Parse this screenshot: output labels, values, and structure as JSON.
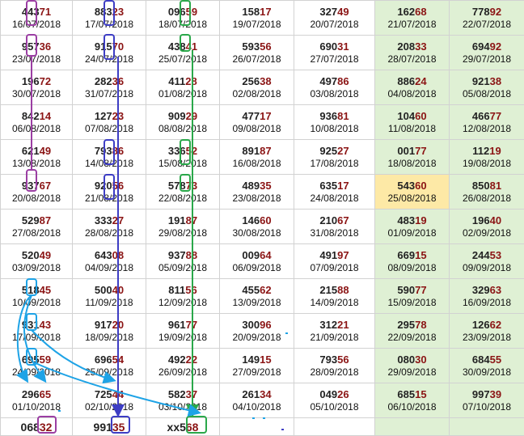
{
  "colors": {
    "green_column": "#dff0d4",
    "highlight_cell": "#fde9a6",
    "number_tail": "#8b1414",
    "grid_line": "#d2d2d2",
    "mark_purple": "#9b3ea3",
    "mark_blue": "#3d3dc4",
    "mark_green": "#2aa84a",
    "mark_cyan": "#1ea3e6"
  },
  "rows": [
    [
      {
        "head": "443",
        "tail": "71",
        "date": "16/07/2018"
      },
      {
        "head": "883",
        "tail": "23",
        "date": "17/07/2018"
      },
      {
        "head": "096",
        "tail": "59",
        "date": "18/07/2018"
      },
      {
        "head": "158",
        "tail": "17",
        "date": "19/07/2018"
      },
      {
        "head": "327",
        "tail": "49",
        "date": "20/07/2018"
      },
      {
        "head": "162",
        "tail": "68",
        "date": "21/07/2018"
      },
      {
        "head": "778",
        "tail": "92",
        "date": "22/07/2018"
      }
    ],
    [
      {
        "head": "957",
        "tail": "36",
        "date": "23/07/2018"
      },
      {
        "head": "915",
        "tail": "70",
        "date": "24/07/2018"
      },
      {
        "head": "438",
        "tail": "41",
        "date": "25/07/2018"
      },
      {
        "head": "593",
        "tail": "56",
        "date": "26/07/2018"
      },
      {
        "head": "690",
        "tail": "31",
        "date": "27/07/2018"
      },
      {
        "head": "208",
        "tail": "33",
        "date": "28/07/2018"
      },
      {
        "head": "694",
        "tail": "92",
        "date": "29/07/2018"
      }
    ],
    [
      {
        "head": "196",
        "tail": "72",
        "date": "30/07/2018"
      },
      {
        "head": "282",
        "tail": "36",
        "date": "31/07/2018"
      },
      {
        "head": "411",
        "tail": "28",
        "date": "01/08/2018"
      },
      {
        "head": "256",
        "tail": "38",
        "date": "02/08/2018"
      },
      {
        "head": "497",
        "tail": "86",
        "date": "03/08/2018"
      },
      {
        "head": "886",
        "tail": "24",
        "date": "04/08/2018"
      },
      {
        "head": "921",
        "tail": "38",
        "date": "05/08/2018"
      }
    ],
    [
      {
        "head": "842",
        "tail": "14",
        "date": "06/08/2018"
      },
      {
        "head": "127",
        "tail": "23",
        "date": "07/08/2018"
      },
      {
        "head": "909",
        "tail": "29",
        "date": "08/08/2018"
      },
      {
        "head": "477",
        "tail": "17",
        "date": "09/08/2018"
      },
      {
        "head": "936",
        "tail": "81",
        "date": "10/08/2018"
      },
      {
        "head": "104",
        "tail": "60",
        "date": "11/08/2018"
      },
      {
        "head": "466",
        "tail": "77",
        "date": "12/08/2018"
      }
    ],
    [
      {
        "head": "621",
        "tail": "49",
        "date": "13/08/2018"
      },
      {
        "head": "793",
        "tail": "86",
        "date": "14/08/2018"
      },
      {
        "head": "336",
        "tail": "52",
        "date": "15/08/2018"
      },
      {
        "head": "891",
        "tail": "87",
        "date": "16/08/2018"
      },
      {
        "head": "925",
        "tail": "27",
        "date": "17/08/2018"
      },
      {
        "head": "001",
        "tail": "77",
        "date": "18/08/2018"
      },
      {
        "head": "112",
        "tail": "19",
        "date": "19/08/2018"
      }
    ],
    [
      {
        "head": "937",
        "tail": "67",
        "date": "20/08/2018"
      },
      {
        "head": "920",
        "tail": "56",
        "date": "21/08/2018"
      },
      {
        "head": "578",
        "tail": "73",
        "date": "22/08/2018"
      },
      {
        "head": "489",
        "tail": "35",
        "date": "23/08/2018"
      },
      {
        "head": "635",
        "tail": "17",
        "date": "24/08/2018"
      },
      {
        "head": "543",
        "tail": "60",
        "date": "25/08/2018"
      },
      {
        "head": "850",
        "tail": "81",
        "date": "26/08/2018"
      }
    ],
    [
      {
        "head": "529",
        "tail": "87",
        "date": "27/08/2018"
      },
      {
        "head": "333",
        "tail": "27",
        "date": "28/08/2018"
      },
      {
        "head": "191",
        "tail": "87",
        "date": "29/08/2018"
      },
      {
        "head": "146",
        "tail": "60",
        "date": "30/08/2018"
      },
      {
        "head": "210",
        "tail": "67",
        "date": "31/08/2018"
      },
      {
        "head": "483",
        "tail": "19",
        "date": "01/09/2018"
      },
      {
        "head": "196",
        "tail": "40",
        "date": "02/09/2018"
      }
    ],
    [
      {
        "head": "520",
        "tail": "49",
        "date": "03/09/2018"
      },
      {
        "head": "643",
        "tail": "08",
        "date": "04/09/2018"
      },
      {
        "head": "937",
        "tail": "88",
        "date": "05/09/2018"
      },
      {
        "head": "009",
        "tail": "64",
        "date": "06/09/2018"
      },
      {
        "head": "491",
        "tail": "97",
        "date": "07/09/2018"
      },
      {
        "head": "669",
        "tail": "15",
        "date": "08/09/2018"
      },
      {
        "head": "244",
        "tail": "53",
        "date": "09/09/2018"
      }
    ],
    [
      {
        "head": "518",
        "tail": "45",
        "date": "10/09/2018"
      },
      {
        "head": "500",
        "tail": "40",
        "date": "11/09/2018"
      },
      {
        "head": "811",
        "tail": "56",
        "date": "12/09/2018"
      },
      {
        "head": "455",
        "tail": "62",
        "date": "13/09/2018"
      },
      {
        "head": "215",
        "tail": "88",
        "date": "14/09/2018"
      },
      {
        "head": "590",
        "tail": "77",
        "date": "15/09/2018"
      },
      {
        "head": "329",
        "tail": "63",
        "date": "16/09/2018"
      }
    ],
    [
      {
        "head": "931",
        "tail": "43",
        "date": "17/09/2018"
      },
      {
        "head": "917",
        "tail": "20",
        "date": "18/09/2018"
      },
      {
        "head": "961",
        "tail": "77",
        "date": "19/09/2018"
      },
      {
        "head": "300",
        "tail": "96",
        "date": "20/09/2018"
      },
      {
        "head": "312",
        "tail": "21",
        "date": "21/09/2018"
      },
      {
        "head": "295",
        "tail": "78",
        "date": "22/09/2018"
      },
      {
        "head": "126",
        "tail": "62",
        "date": "23/09/2018"
      }
    ],
    [
      {
        "head": "695",
        "tail": "59",
        "date": "24/09/2018"
      },
      {
        "head": "696",
        "tail": "54",
        "date": "25/09/2018"
      },
      {
        "head": "492",
        "tail": "22",
        "date": "26/09/2018"
      },
      {
        "head": "149",
        "tail": "15",
        "date": "27/09/2018"
      },
      {
        "head": "793",
        "tail": "56",
        "date": "28/09/2018"
      },
      {
        "head": "080",
        "tail": "30",
        "date": "29/09/2018"
      },
      {
        "head": "684",
        "tail": "55",
        "date": "30/09/2018"
      }
    ],
    [
      {
        "head": "296",
        "tail": "65",
        "date": "01/10/2018"
      },
      {
        "head": "725",
        "tail": "44",
        "date": "02/10/2018"
      },
      {
        "head": "582",
        "tail": "37",
        "date": "03/10/2018"
      },
      {
        "head": "261",
        "tail": "34",
        "date": "04/10/2018"
      },
      {
        "head": "049",
        "tail": "26",
        "date": "05/10/2018"
      },
      {
        "head": "685",
        "tail": "15",
        "date": "06/10/2018"
      },
      {
        "head": "997",
        "tail": "39",
        "date": "07/10/2018"
      }
    ],
    [
      {
        "head": "068",
        "tail": "32",
        "date": ""
      },
      {
        "head": "991",
        "tail": "35",
        "date": ""
      },
      {
        "head": "xx5",
        "tail": "68",
        "date": ""
      },
      {
        "head": "",
        "tail": "",
        "date": ""
      },
      {
        "head": "",
        "tail": "",
        "date": ""
      },
      {
        "head": "",
        "tail": "",
        "date": ""
      },
      {
        "head": "",
        "tail": "",
        "date": ""
      }
    ]
  ]
}
